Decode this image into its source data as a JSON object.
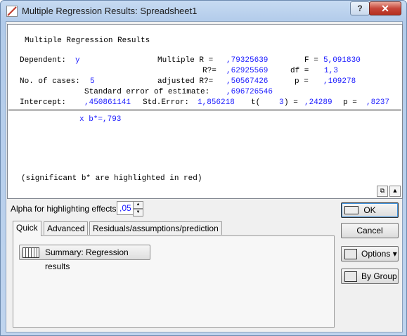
{
  "window": {
    "title": "Multiple Regression Results: Spreadsheet1",
    "help_label": "?",
    "close_label": "✕"
  },
  "output": {
    "heading": "Multiple Regression Results",
    "dependent_label": "Dependent:",
    "dependent_value": "y",
    "multiple_r_label": "Multiple R =",
    "multiple_r_value": ",79325639",
    "f_label": "F =",
    "f_value": "5,091830",
    "r2_label": "R?=",
    "r2_value": ",62925569",
    "df_label": "df =",
    "df_value": "1,3",
    "n_cases_label": "No. of cases:",
    "n_cases_value": "5",
    "adj_r2_label": "adjusted R?=",
    "adj_r2_value": ",50567426",
    "p_label": "p =",
    "p_value": ",109278",
    "se_label": "Standard error of estimate:",
    "se_value": ",696726546",
    "intercept_label": "Intercept:",
    "intercept_value": ",450861141",
    "std_error_label": "Std.Error:",
    "std_error_value": "1,856218",
    "t_label": "t(",
    "t_df": "3",
    "t_close": ") =",
    "t_value": ",24289",
    "p2_label": "p =",
    "p2_value": ",8237",
    "coef_line": "x b*=,793",
    "footnote": "(significant b* are highlighted in red)"
  },
  "alpha": {
    "label": "Alpha for highlighting effects:",
    "value": ",05"
  },
  "tabs": [
    {
      "label": "Quick",
      "active": true
    },
    {
      "label": "Advanced",
      "active": false
    },
    {
      "label": "Residuals/assumptions/prediction",
      "active": false
    }
  ],
  "quick": {
    "summary_label": "Summary:  Regression results"
  },
  "buttons": {
    "ok": "OK",
    "cancel": "Cancel",
    "options": "Options ▾",
    "by_group": "By Group"
  },
  "colors": {
    "value_blue": "#1a1aff"
  }
}
